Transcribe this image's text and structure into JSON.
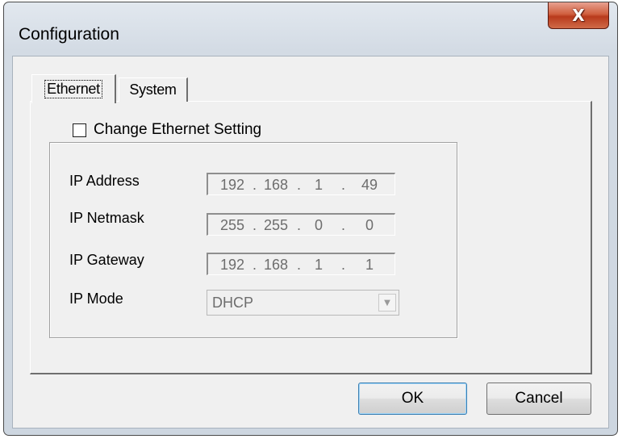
{
  "window": {
    "title": "Configuration",
    "close_symbol": "X"
  },
  "tabs": [
    {
      "label": "Ethernet",
      "active": true
    },
    {
      "label": "System",
      "active": false
    }
  ],
  "ethernet": {
    "change_setting_label": "Change Ethernet Setting",
    "change_setting_checked": false,
    "ip_address_label": "IP Address",
    "ip_address": [
      "192",
      "168",
      "1",
      "49"
    ],
    "ip_netmask_label": "IP Netmask",
    "ip_netmask": [
      "255",
      "255",
      "0",
      "0"
    ],
    "ip_gateway_label": "IP Gateway",
    "ip_gateway": [
      "192",
      "168",
      "1",
      "1"
    ],
    "ip_mode_label": "IP Mode",
    "ip_mode_value": "DHCP"
  },
  "buttons": {
    "ok": "OK",
    "cancel": "Cancel"
  }
}
